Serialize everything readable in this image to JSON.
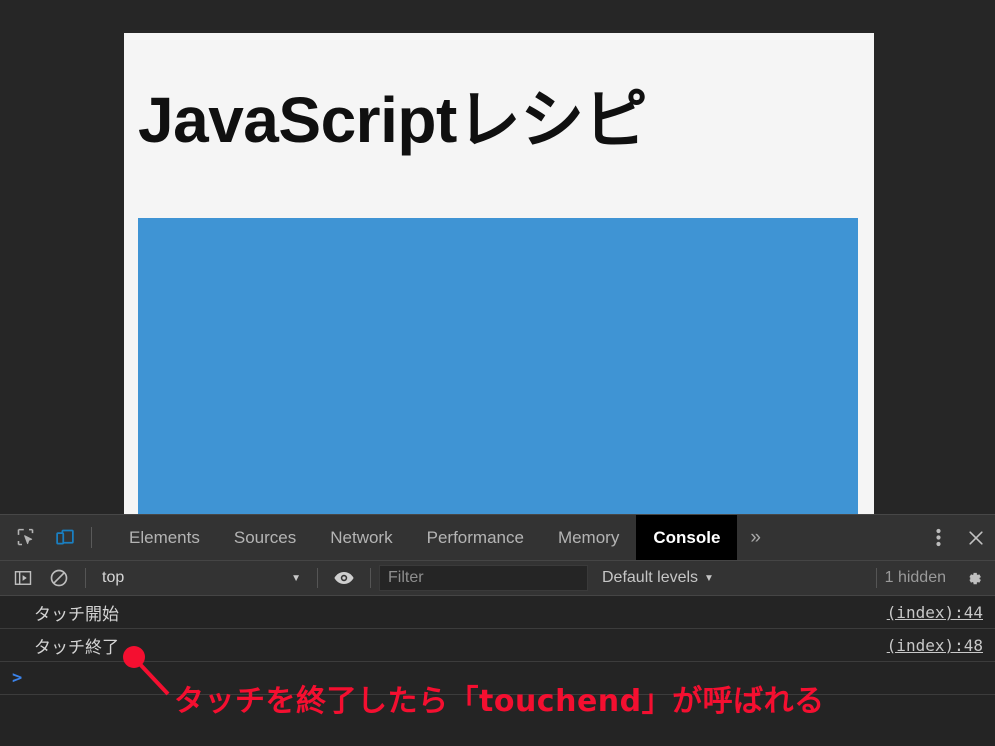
{
  "page": {
    "title": "JavaScriptレシピ",
    "touch_area_name": "touch-target",
    "background_color": "#f5f5f5",
    "touch_area_color": "#3f94d4"
  },
  "devtools": {
    "tabs": [
      {
        "label": "Elements",
        "active": false
      },
      {
        "label": "Sources",
        "active": false
      },
      {
        "label": "Network",
        "active": false
      },
      {
        "label": "Performance",
        "active": false
      },
      {
        "label": "Memory",
        "active": false
      },
      {
        "label": "Console",
        "active": true
      }
    ],
    "more_tabs_label": "»",
    "inspect_icon": "inspect-element-icon",
    "device_toolbar_icon": "device-toolbar-icon",
    "device_toolbar_active_color": "#1a7fc1",
    "menu_icon": "vertical-dots-icon",
    "close_icon": "close-icon"
  },
  "console_toolbar": {
    "sidebar_toggle_icon": "console-sidebar-icon",
    "clear_icon": "clear-console-icon",
    "context": "top",
    "context_caret": "▼",
    "live_expression_icon": "eye-icon",
    "filter_value": "",
    "filter_placeholder": "Filter",
    "levels": "Default levels",
    "levels_caret": "▼",
    "hidden_count": "1 hidden",
    "settings_icon": "gear-icon"
  },
  "console": {
    "messages": [
      {
        "text": "タッチ開始",
        "source": "(index):44"
      },
      {
        "text": "タッチ終了",
        "source": "(index):48"
      }
    ],
    "prompt_caret": ">",
    "prompt_value": "",
    "prompt_placeholder": ""
  },
  "annotation": {
    "text": "タッチを終了したら「touchend」が呼ばれる",
    "color": "#f40f30",
    "marker_name": "annotation-dot"
  }
}
